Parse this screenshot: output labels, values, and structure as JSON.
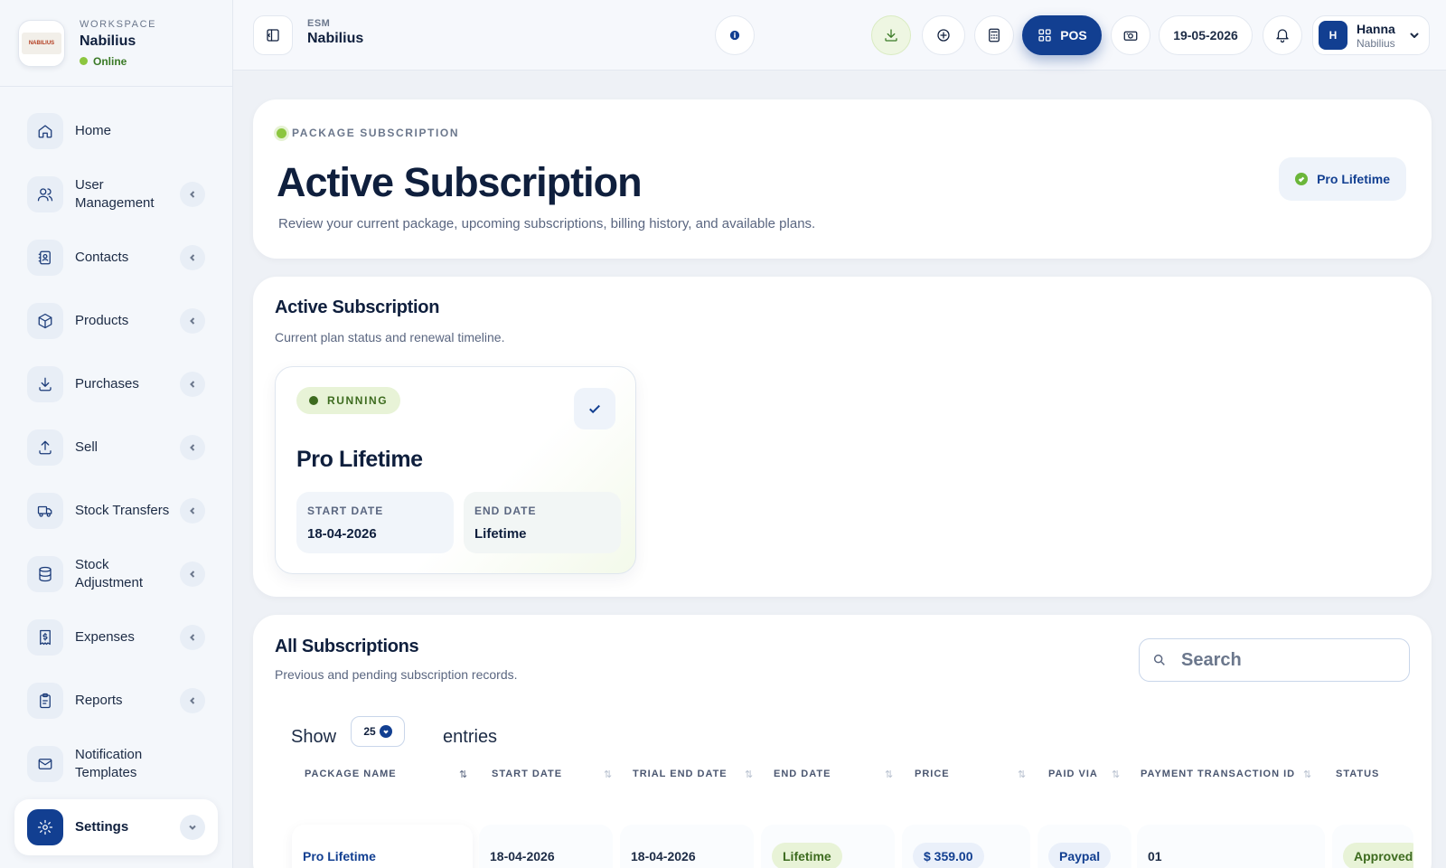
{
  "workspace": {
    "label": "WORKSPACE",
    "name": "Nabilius",
    "status": "Online",
    "logo_text": "NABILIUS"
  },
  "sidebar": {
    "items": [
      {
        "label": "Home",
        "icon": "home-icon"
      },
      {
        "label": "User Management",
        "icon": "users-icon"
      },
      {
        "label": "Contacts",
        "icon": "contacts-icon"
      },
      {
        "label": "Products",
        "icon": "box-icon"
      },
      {
        "label": "Purchases",
        "icon": "download-icon"
      },
      {
        "label": "Sell",
        "icon": "upload-icon"
      },
      {
        "label": "Stock Transfers",
        "icon": "truck-icon"
      },
      {
        "label": "Stock Adjustment",
        "icon": "database-icon"
      },
      {
        "label": "Expenses",
        "icon": "receipt-icon"
      },
      {
        "label": "Reports",
        "icon": "clipboard-icon"
      },
      {
        "label": "Notification Templates",
        "icon": "mail-icon"
      },
      {
        "label": "Settings",
        "icon": "gear-icon",
        "active": true
      }
    ]
  },
  "header": {
    "esm_label": "ESM",
    "esm_name": "Nabilius",
    "pos_label": "POS",
    "date": "19-05-2026",
    "user": {
      "initial": "H",
      "name": "Hanna",
      "sub": "Nabilius"
    }
  },
  "hero": {
    "eyebrow": "PACKAGE SUBSCRIPTION",
    "title": "Active Subscription",
    "subtitle": "Review your current package, upcoming subscriptions, billing history, and available plans.",
    "badge": "Pro Lifetime"
  },
  "active": {
    "title": "Active Subscription",
    "subtitle": "Current plan status and renewal timeline.",
    "plan": {
      "status": "RUNNING",
      "name": "Pro Lifetime",
      "start_label": "START DATE",
      "start_value": "18-04-2026",
      "end_label": "END DATE",
      "end_value": "Lifetime"
    }
  },
  "all": {
    "title": "All Subscriptions",
    "subtitle": "Previous and pending subscription records.",
    "search_placeholder": "Search",
    "show_label": "Show",
    "entries_value": "25",
    "entries_label": "entries",
    "columns": [
      "PACKAGE NAME",
      "START DATE",
      "TRIAL END DATE",
      "END DATE",
      "PRICE",
      "PAID VIA",
      "PAYMENT TRANSACTION ID",
      "STATUS"
    ],
    "rows": [
      {
        "package": "Pro Lifetime",
        "start": "18-04-2026",
        "trial_end": "18-04-2026",
        "end": "Lifetime",
        "price": "$ 359.00",
        "paid_via": "Paypal",
        "txn": "01",
        "status": "Approved"
      }
    ]
  }
}
